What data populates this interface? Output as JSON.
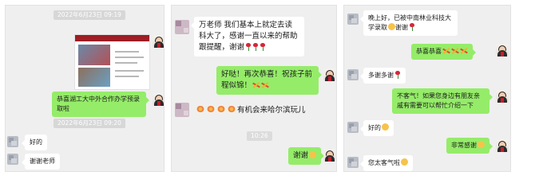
{
  "panel1": {
    "timestamp_top": "2022年6月23日 09:19",
    "timestamp_bottom": "2022年6月23日 09:20",
    "msg_congrats": "恭喜湖工大中外合作办学预录取啦",
    "msg_ok": "好的",
    "msg_thanks": "谢谢老师"
  },
  "panel2": {
    "msg_first": "万老师 我们基本上就定去读科大了，感谢一直以来的帮助跟提醒，谢谢",
    "msg_reply": "好哒！再次恭喜！祝孩子前程似锦！",
    "msg_harbin": "有机会来哈尔滨玩儿",
    "timestamp": "10:26",
    "msg_thank": "谢谢"
  },
  "panel3": {
    "msg_first": "晚上好，已被中南林业科技大学录取",
    "msg_first_tail": "谢谢",
    "msg_congrats": "恭喜恭喜",
    "msg_thanks_many": "多谢多谢",
    "msg_welcome": "不客气！如果您身边有朋友亲戚有需要可以帮忙介绍一下",
    "msg_ok": "好的",
    "msg_very_thanks": "非常感谢",
    "msg_too_polite": "您太客气啦"
  }
}
